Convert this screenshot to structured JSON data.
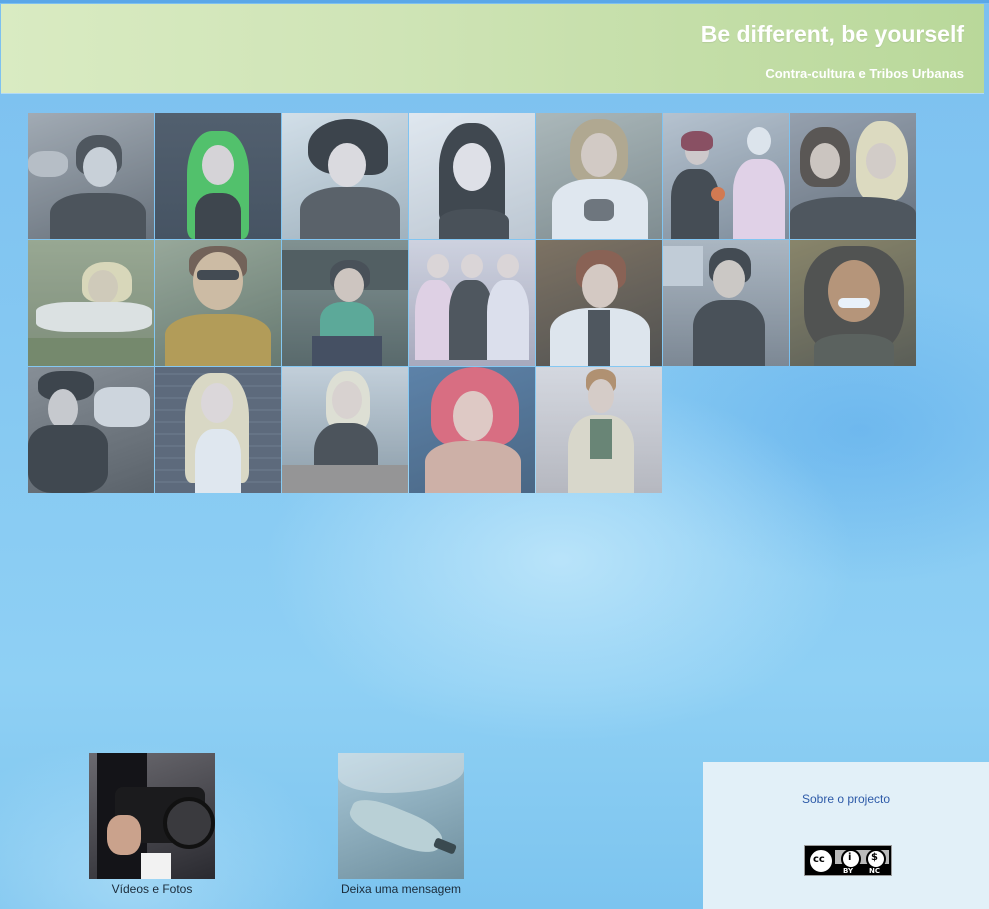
{
  "header": {
    "title": "Be different, be yourself",
    "subtitle": "Contra-cultura e Tribos Urbanas"
  },
  "gallery": {
    "tiles": [
      {
        "name": "tribe-photo-1",
        "bg": "#6b6d70"
      },
      {
        "name": "tribe-photo-2",
        "bg": "#3f4a56"
      },
      {
        "name": "tribe-photo-3",
        "bg": "#8fa0a8"
      },
      {
        "name": "tribe-photo-4",
        "bg": "#bfc3c8"
      },
      {
        "name": "tribe-photo-5",
        "bg": "#9aa39a"
      },
      {
        "name": "tribe-photo-6",
        "bg": "#7b848c"
      },
      {
        "name": "tribe-photo-7",
        "bg": "#5e6268"
      },
      {
        "name": "tribe-photo-8",
        "bg": "#8c9470"
      },
      {
        "name": "tribe-photo-9",
        "bg": "#6f7a58"
      },
      {
        "name": "tribe-photo-10",
        "bg": "#5d6a5a"
      },
      {
        "name": "tribe-photo-11",
        "bg": "#b7b4c0"
      },
      {
        "name": "tribe-photo-12",
        "bg": "#5c5040"
      },
      {
        "name": "tribe-photo-13",
        "bg": "#8a8d92"
      },
      {
        "name": "tribe-photo-14",
        "bg": "#6a5a2a"
      },
      {
        "name": "tribe-photo-15",
        "bg": "#4a4a4a"
      },
      {
        "name": "tribe-photo-16",
        "bg": "#3e4652"
      },
      {
        "name": "tribe-photo-17",
        "bg": "#9aa8b0"
      },
      {
        "name": "tribe-photo-18",
        "bg": "#3a5a7a"
      },
      {
        "name": "tribe-photo-19",
        "bg": "#c9c2c4"
      }
    ]
  },
  "links": {
    "videos_label": "Vídeos e Fotos",
    "message_label": "Deixa uma mensagem"
  },
  "panel": {
    "about_label": "Sobre o projecto"
  },
  "license": {
    "by": "BY",
    "nc": "NC"
  }
}
